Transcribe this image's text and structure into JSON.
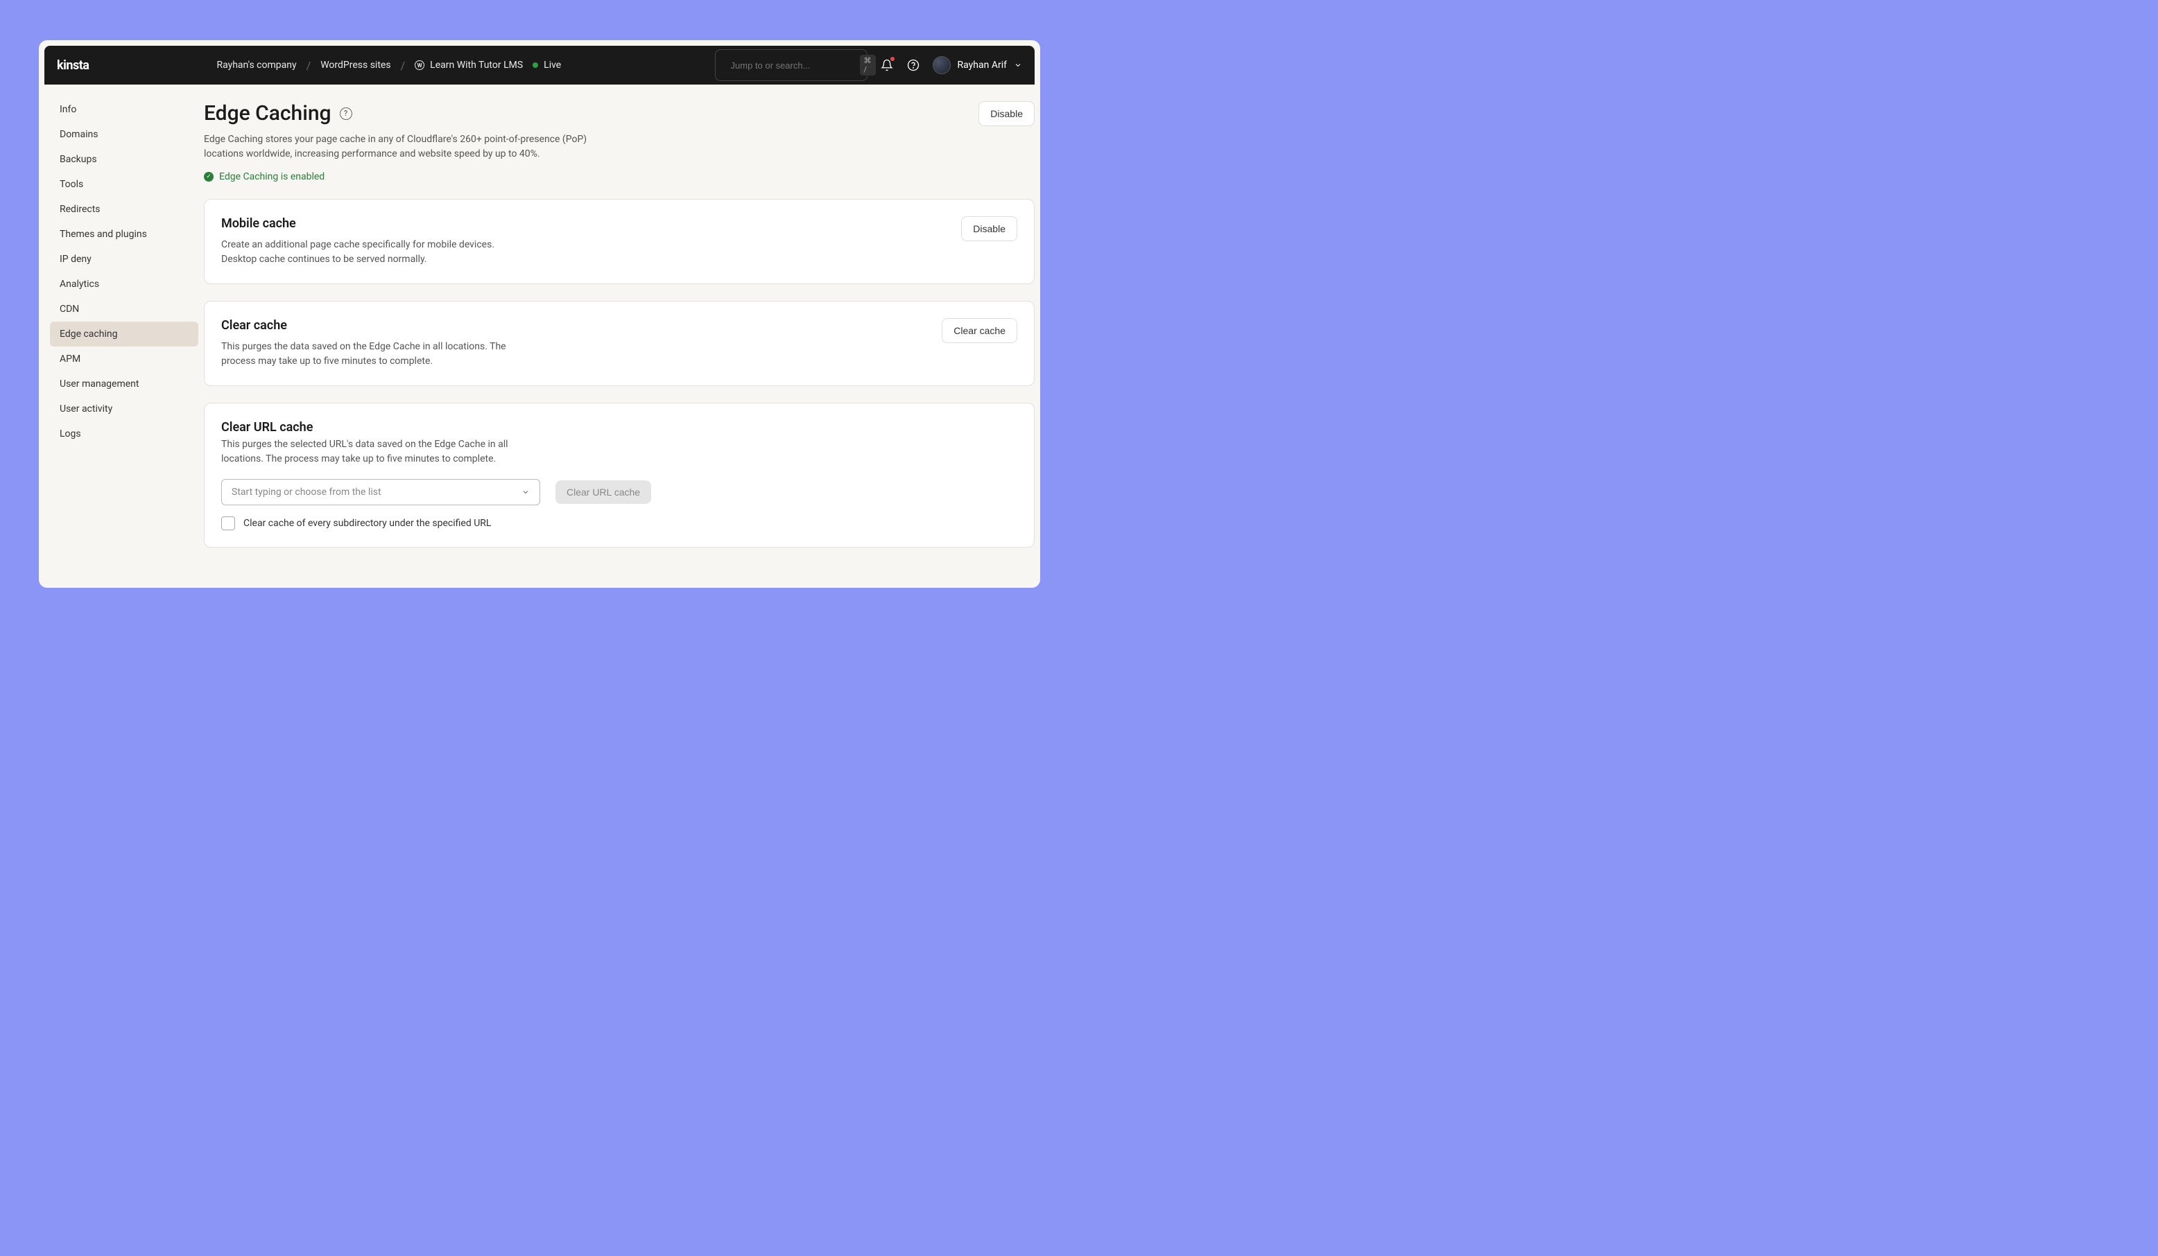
{
  "header": {
    "logo": "kinsta",
    "breadcrumb": {
      "company": "Rayhan's company",
      "section": "WordPress sites",
      "site": "Learn With Tutor LMS",
      "status": "Live"
    },
    "search": {
      "placeholder": "Jump to or search...",
      "shortcut": "⌘ /"
    },
    "user": "Rayhan Arif"
  },
  "sidebar": {
    "items": [
      {
        "label": "Info"
      },
      {
        "label": "Domains"
      },
      {
        "label": "Backups"
      },
      {
        "label": "Tools"
      },
      {
        "label": "Redirects"
      },
      {
        "label": "Themes and plugins"
      },
      {
        "label": "IP deny"
      },
      {
        "label": "Analytics"
      },
      {
        "label": "CDN"
      },
      {
        "label": "Edge caching"
      },
      {
        "label": "APM"
      },
      {
        "label": "User management"
      },
      {
        "label": "User activity"
      },
      {
        "label": "Logs"
      }
    ]
  },
  "page": {
    "title": "Edge Caching",
    "description": "Edge Caching stores your page cache in any of Cloudflare's 260+ point-of-presence (PoP) locations worldwide, increasing performance and website speed by up to 40%.",
    "status": "Edge Caching is enabled",
    "disable_button": "Disable"
  },
  "cards": {
    "mobile": {
      "title": "Mobile cache",
      "description": "Create an additional page cache specifically for mobile devices. Desktop cache continues to be served normally.",
      "button": "Disable"
    },
    "clear": {
      "title": "Clear cache",
      "description": "This purges the data saved on the Edge Cache in all locations. The process may take up to five minutes to complete.",
      "button": "Clear cache"
    },
    "url": {
      "title": "Clear URL cache",
      "description": "This purges the selected URL's data saved on the Edge Cache in all locations. The process may take up to five minutes to complete.",
      "combobox_placeholder": "Start typing or choose from the list",
      "button": "Clear URL cache",
      "checkbox_label": "Clear cache of every subdirectory under the specified URL"
    }
  }
}
